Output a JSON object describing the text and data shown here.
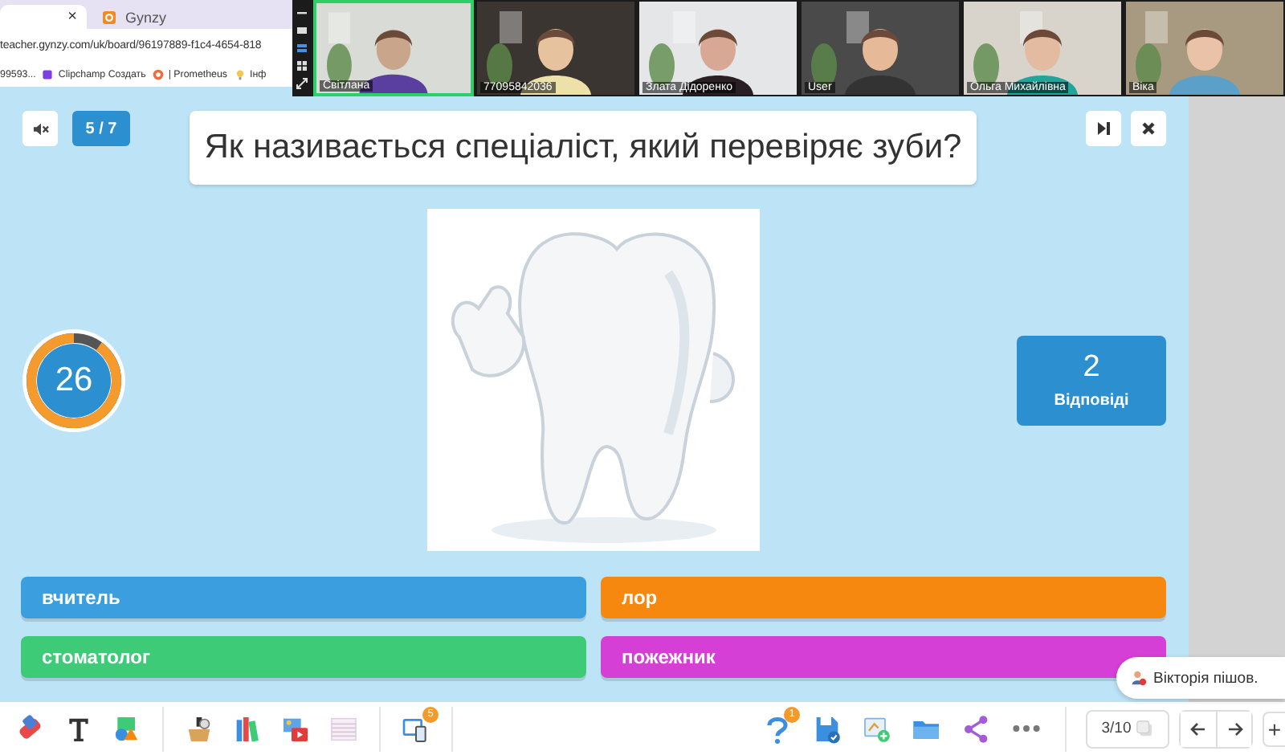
{
  "browser": {
    "tabs": [
      {
        "selected": true,
        "close": "×"
      },
      {
        "selected": false,
        "label": "Gynzy"
      }
    ],
    "address": "teacher.gynzy.com/uk/board/96197889-f1c4-4654-818",
    "bookmarks": [
      {
        "kind": "plain",
        "label": "99593..."
      },
      {
        "kind": "clipchamp",
        "label": "Clipchamp Создать"
      },
      {
        "kind": "prometheus",
        "label": "| Prometheus"
      },
      {
        "kind": "bulb",
        "label": "Інф"
      }
    ]
  },
  "video_call": {
    "participants": [
      {
        "name": "Світлана",
        "speaking": true
      },
      {
        "name": "77095842036",
        "speaking": false
      },
      {
        "name": "Злата Дідоренко",
        "speaking": false
      },
      {
        "name": "User",
        "speaking": false
      },
      {
        "name": "Ольга Михайлівна",
        "speaking": false
      },
      {
        "name": "Віка",
        "speaking": false
      }
    ]
  },
  "quiz": {
    "progress": "5 / 7",
    "question": "Як називається спеціаліст, який перевіряє зуби?",
    "timer": {
      "value": "26",
      "level": 0.9
    },
    "responses": {
      "count": "2",
      "label": "Відповіді"
    },
    "answers": [
      {
        "text": "вчитель",
        "color": "#3b9fdf"
      },
      {
        "text": "лор",
        "color": "#f7880f"
      },
      {
        "text": "стоматолог",
        "color": "#3ecb78"
      },
      {
        "text": "пожежник",
        "color": "#d63fd6"
      }
    ]
  },
  "toast": {
    "text": "Вікторія пішов."
  },
  "toolbar": {
    "left_groups": [
      [
        {
          "kind": "eraser"
        },
        {
          "kind": "text"
        },
        {
          "kind": "shapes"
        }
      ],
      [
        {
          "kind": "box"
        },
        {
          "kind": "books"
        },
        {
          "kind": "media"
        },
        {
          "kind": "lines"
        }
      ],
      [
        {
          "kind": "devices",
          "badge": "5"
        }
      ]
    ],
    "right": [
      {
        "kind": "question",
        "badge": "1"
      },
      {
        "kind": "save"
      },
      {
        "kind": "add-image"
      },
      {
        "kind": "folder"
      },
      {
        "kind": "share"
      },
      {
        "kind": "more"
      }
    ],
    "page": "3/10",
    "add": "+"
  }
}
